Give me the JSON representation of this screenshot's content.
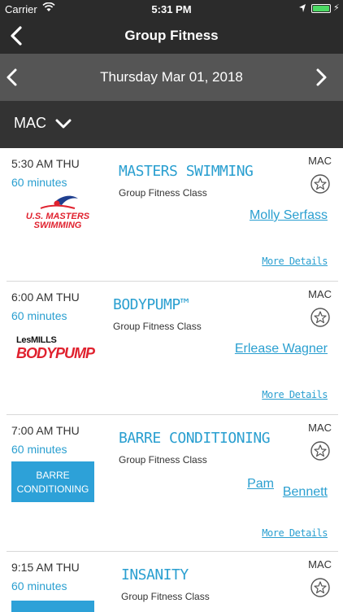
{
  "status_bar": {
    "carrier": "Carrier",
    "time": "5:31 PM"
  },
  "nav": {
    "title": "Group Fitness"
  },
  "date_bar": {
    "date": "Thursday Mar 01, 2018"
  },
  "filter": {
    "location": "MAC"
  },
  "colors": {
    "accent": "#2a9fd0",
    "nav_bg": "#2b2b2b",
    "date_bg": "#555555",
    "filter_bg": "#333333",
    "battery": "#4cd964"
  },
  "classes": [
    {
      "time": "5:30 AM THU",
      "duration": "60 minutes",
      "name": "MASTERS SWIMMING",
      "type": "Group Fitness Class",
      "location": "MAC",
      "instructor": "Molly Serfass",
      "more": "More Details",
      "logo_line1": "U.S. MASTERS",
      "logo_line2": "SWIMMING"
    },
    {
      "time": "6:00 AM THU",
      "duration": "60 minutes",
      "name": "BODYPUMP™",
      "type": "Group Fitness Class",
      "location": "MAC",
      "instructor": "Erlease Wagner",
      "more": "More Details",
      "logo_line1": "LesMILLS",
      "logo_line2": "BODYPUMP"
    },
    {
      "time": "7:00 AM THU",
      "duration": "60 minutes",
      "name": "BARRE CONDITIONING",
      "type": "Group Fitness Class",
      "location": "MAC",
      "instructor_first": "Pam",
      "instructor_last": "Bennett",
      "more": "More Details",
      "logo_line1": "BARRE",
      "logo_line2": "CONDITIONING"
    },
    {
      "time": "9:15 AM THU",
      "duration": "60 minutes",
      "name": "INSANITY",
      "type": "Group Fitness Class",
      "location": "MAC"
    }
  ]
}
